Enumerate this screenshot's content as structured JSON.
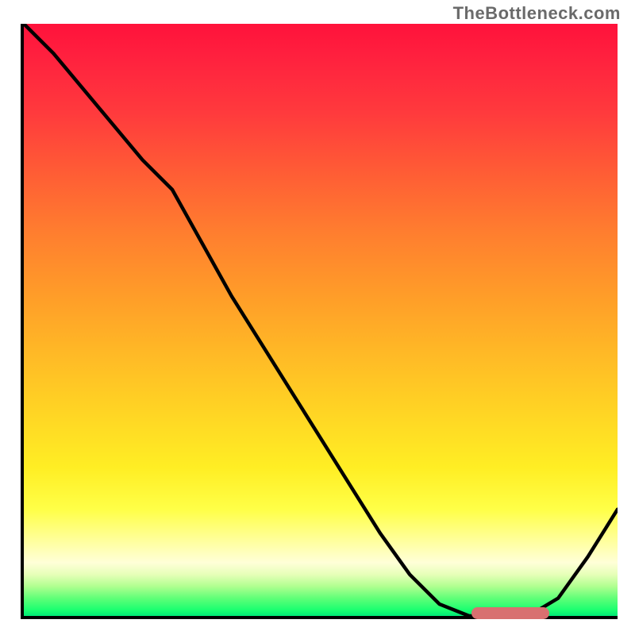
{
  "watermark": "TheBottleneck.com",
  "chart_data": {
    "type": "line",
    "title": "",
    "xlabel": "",
    "ylabel": "",
    "xlim": [
      0,
      100
    ],
    "ylim": [
      0,
      100
    ],
    "x": [
      0,
      5,
      10,
      15,
      20,
      25,
      30,
      35,
      40,
      45,
      50,
      55,
      60,
      65,
      70,
      75,
      80,
      85,
      90,
      95,
      100
    ],
    "values": [
      100,
      95,
      89,
      83,
      77,
      72,
      63,
      54,
      46,
      38,
      30,
      22,
      14,
      7,
      2,
      0,
      0,
      0,
      3,
      10,
      18
    ],
    "highlight_range_x": [
      75,
      88
    ],
    "highlight_y": 1,
    "background_gradient": {
      "type": "vertical",
      "stops": [
        {
          "pos": 0,
          "color": "#ff123b"
        },
        {
          "pos": 50,
          "color": "#ffb726"
        },
        {
          "pos": 82,
          "color": "#ffff47"
        },
        {
          "pos": 95,
          "color": "#b0ff90"
        },
        {
          "pos": 100,
          "color": "#00e876"
        }
      ]
    }
  }
}
